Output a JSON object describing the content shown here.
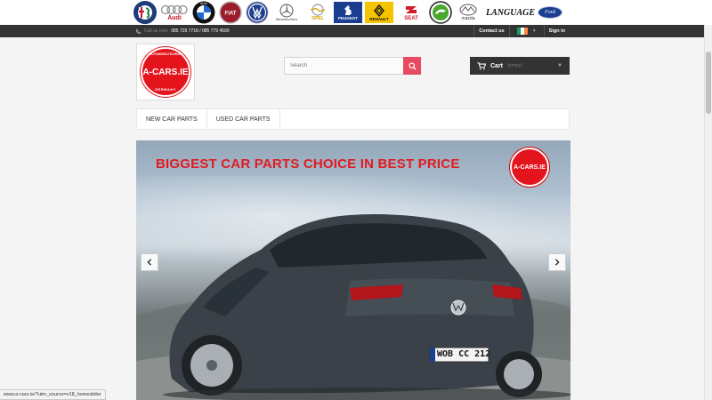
{
  "brands": {
    "alfa_romeo": "Alfa Romeo",
    "audi": "Audi",
    "bmw": "BMW",
    "fiat": "FIAT",
    "volkswagen": "VW",
    "mercedes": "Mercedes-Benz",
    "opel": "OPEL",
    "peugeot": "PEUGEOT",
    "renault": "RENAULT",
    "seat": "SEAT",
    "skoda": "ŠKODA",
    "mazda": "mazda",
    "ford": "Ford"
  },
  "language_label": "LANGUAGE",
  "topbar": {
    "call_us_label": "Call us now:",
    "phone": "085 729 7718 / 085 779 4590",
    "contact_us": "Contact us",
    "sign_in": "Sign in",
    "flag_colors": [
      "#169b62",
      "#ffffff",
      "#ff883e"
    ]
  },
  "logo": {
    "ring_top": "AUTOMOBILTECHNIK",
    "main": "A-CARS.IE",
    "ring_bottom": "GERMANY"
  },
  "search": {
    "placeholder": "Search",
    "button_color": "#e84a5f"
  },
  "cart": {
    "label": "Cart",
    "status": "(empty)"
  },
  "menu": {
    "items": [
      "NEW CAR PARTS",
      "USED CAR PARTS"
    ]
  },
  "slider": {
    "headline": "BIGGEST CAR PARTS CHOICE IN BEST PRICE",
    "badge_text": "A-CARS.IE",
    "plate": "WOB CC 212",
    "accent_color": "#e11b22"
  },
  "status_bar": {
    "url": "www.a-cars.ie/?utm_source=v18_homeslider"
  }
}
